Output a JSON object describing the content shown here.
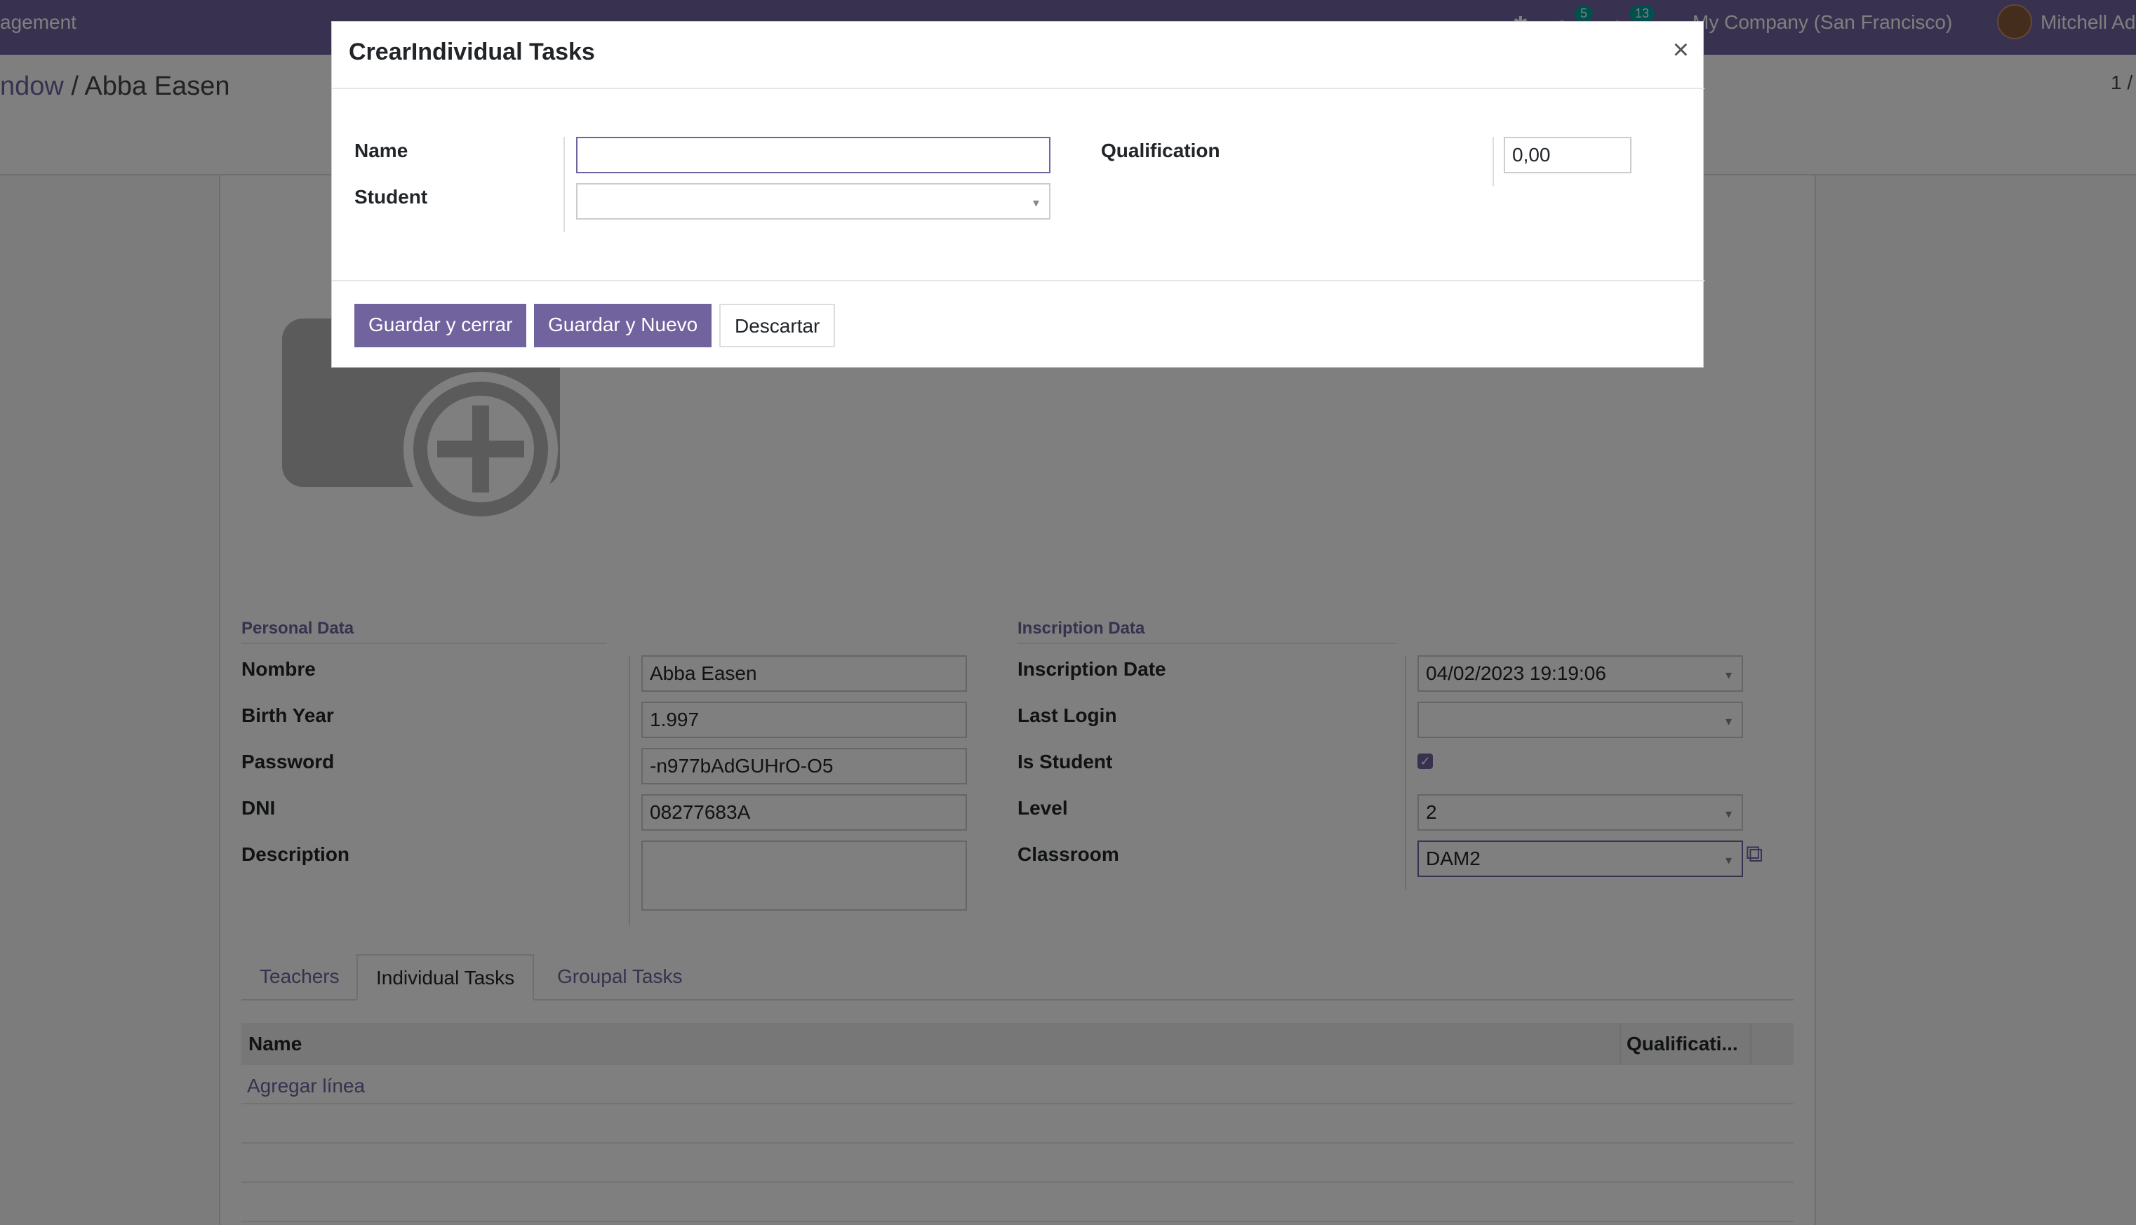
{
  "topbar": {
    "app_name": "agement",
    "chat_badge": "5",
    "activity_badge": "13",
    "company": "My Company (San Francisco)",
    "user": "Mitchell Ad"
  },
  "breadcrumb": {
    "parent": "ndow",
    "separator": " / ",
    "current": "Abba Easen"
  },
  "pager": "1 /",
  "form": {
    "personal_section": "Personal Data",
    "inscription_section": "Inscription Data",
    "fields": {
      "nombre_label": "Nombre",
      "nombre_value": "Abba Easen",
      "birth_year_label": "Birth Year",
      "birth_year_value": "1.997",
      "password_label": "Password",
      "password_value": "-n977bAdGUHrO-O5",
      "dni_label": "DNI",
      "dni_value": "08277683A",
      "description_label": "Description",
      "description_value": "",
      "inscription_date_label": "Inscription Date",
      "inscription_date_value": "04/02/2023 19:19:06",
      "last_login_label": "Last Login",
      "last_login_value": "",
      "is_student_label": "Is Student",
      "is_student_checked": true,
      "level_label": "Level",
      "level_value": "2",
      "classroom_label": "Classroom",
      "classroom_value": "DAM2"
    },
    "tabs": [
      "Teachers",
      "Individual Tasks",
      "Groupal Tasks"
    ],
    "active_tab": "Individual Tasks",
    "list": {
      "col_name": "Name",
      "col_qualification": "Qualificati...",
      "add_line": "Agregar línea"
    }
  },
  "modal": {
    "title": "CrearIndividual Tasks",
    "name_label": "Name",
    "name_value": "",
    "student_label": "Student",
    "student_value": "",
    "qualification_label": "Qualification",
    "qualification_value": "0,00",
    "save_close": "Guardar y cerrar",
    "save_new": "Guardar y Nuevo",
    "discard": "Descartar"
  },
  "colors": {
    "primary": "#71639e",
    "overlay": "rgba(0,0,0,0.5)"
  },
  "icons": {
    "close": "close-icon",
    "camera_add": "camera-plus-icon",
    "external": "external-link-icon"
  }
}
